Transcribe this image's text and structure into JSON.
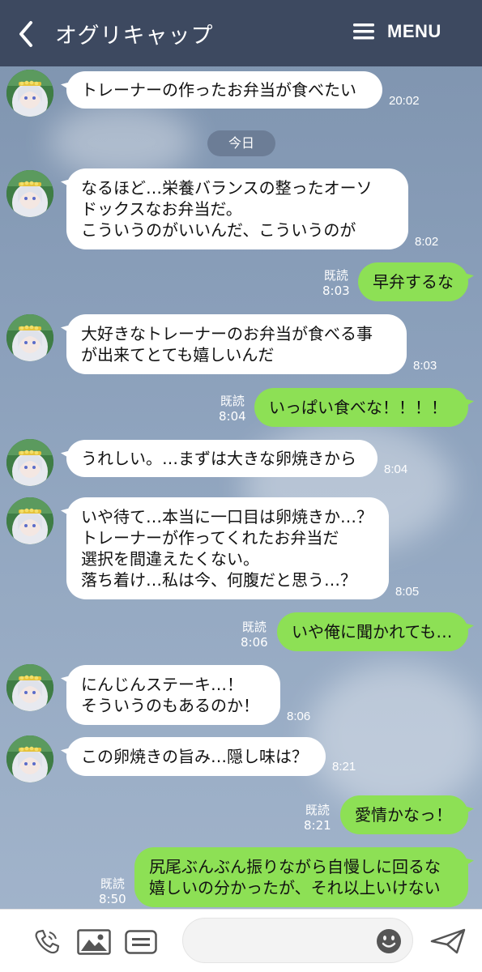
{
  "header": {
    "title": "オグリキャップ",
    "menu_label": "MENU"
  },
  "date_separator": "今日",
  "messages": [
    {
      "side": "in",
      "lines": [
        "トレーナーの作ったお弁当が食べたい"
      ],
      "time": "20:02"
    },
    {
      "side": "in",
      "lines": [
        "なるほど…栄養バランスの整ったオーソ",
        "ドックスなお弁当だ。",
        "こういうのがいいんだ、こういうのが"
      ],
      "time": "8:02"
    },
    {
      "side": "out",
      "lines": [
        "早弁するな"
      ],
      "read": "既読",
      "time": "8:03"
    },
    {
      "side": "in",
      "lines": [
        "大好きなトレーナーのお弁当が食べる事",
        "が出来てとても嬉しいんだ"
      ],
      "time": "8:03"
    },
    {
      "side": "out",
      "lines": [
        "いっぱい食べな！！！！"
      ],
      "read": "既読",
      "time": "8:04"
    },
    {
      "side": "in",
      "lines": [
        "うれしい。…まずは大きな卵焼きから"
      ],
      "time": "8:04"
    },
    {
      "side": "in",
      "lines": [
        "いや待て…本当に一口目は卵焼きか…？",
        "トレーナーが作ってくれたお弁当だ",
        "選択を間違えたくない。",
        "落ち着け…私は今、何腹だと思う…？"
      ],
      "time": "8:05"
    },
    {
      "side": "out",
      "lines": [
        "いや俺に聞かれても…"
      ],
      "read": "既読",
      "time": "8:06"
    },
    {
      "side": "in",
      "lines": [
        "にんじんステーキ…！",
        "そういうのもあるのか！"
      ],
      "time": "8:06"
    },
    {
      "side": "in",
      "lines": [
        "この卵焼きの旨み…隠し味は？"
      ],
      "time": "8:21"
    },
    {
      "side": "out",
      "lines": [
        "愛情かなっ！"
      ],
      "read": "既読",
      "time": "8:21"
    },
    {
      "side": "out",
      "lines": [
        "尻尾ぶんぶん振りながら自慢しに回るな",
        "嬉しいの分かったが、それ以上いけない"
      ],
      "read": "既読",
      "time": "8:50"
    }
  ],
  "footer": {
    "icons": [
      "phone-icon",
      "image-icon",
      "list-icon",
      "emoji-icon",
      "send-icon"
    ],
    "input_value": ""
  },
  "colors": {
    "header": "#3d4960",
    "incoming_bubble": "#ffffff",
    "outgoing_bubble": "#8de055",
    "date_pill": "#6c7d96"
  }
}
